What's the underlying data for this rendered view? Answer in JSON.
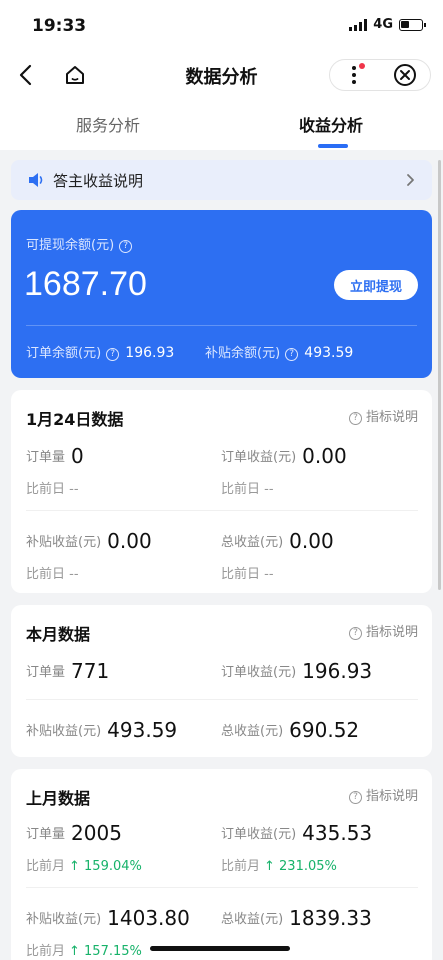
{
  "status_bar": {
    "time": "19:33",
    "network": "4G"
  },
  "nav": {
    "title": "数据分析"
  },
  "tabs": [
    {
      "label": "服务分析",
      "active": false
    },
    {
      "label": "收益分析",
      "active": true
    }
  ],
  "notice": {
    "text": "答主收益说明"
  },
  "balance": {
    "label": "可提现余额(元)",
    "amount": "1687.70",
    "withdraw_label": "立即提现",
    "order_label": "订单余额(元)",
    "order_value": "196.93",
    "subsidy_label": "补贴余额(元)",
    "subsidy_value": "493.59"
  },
  "help_label": "指标说明",
  "today": {
    "title": "1月24日数据",
    "order_count_label": "订单量",
    "order_count": "0",
    "order_income_label": "订单收益(元)",
    "order_income": "0.00",
    "compare_label": "比前日",
    "compare_value": "--",
    "subsidy_income_label": "补贴收益(元)",
    "subsidy_income": "0.00",
    "total_income_label": "总收益(元)",
    "total_income": "0.00"
  },
  "month": {
    "title": "本月数据",
    "order_count_label": "订单量",
    "order_count": "771",
    "order_income_label": "订单收益(元)",
    "order_income": "196.93",
    "subsidy_income_label": "补贴收益(元)",
    "subsidy_income": "493.59",
    "total_income_label": "总收益(元)",
    "total_income": "690.52"
  },
  "last_month": {
    "title": "上月数据",
    "order_count_label": "订单量",
    "order_count": "2005",
    "order_income_label": "订单收益(元)",
    "order_income": "435.53",
    "compare_label": "比前月",
    "order_count_change": "↑ 159.04%",
    "order_income_change": "↑ 231.05%",
    "subsidy_income_label": "补贴收益(元)",
    "subsidy_income": "1403.80",
    "subsidy_income_change": "↑ 157.15%",
    "total_income_label": "总收益(元)",
    "total_income": "1839.33"
  },
  "colors": {
    "accent": "#2d6ff2",
    "up": "#17b26a",
    "background": "#f2f3f5"
  }
}
